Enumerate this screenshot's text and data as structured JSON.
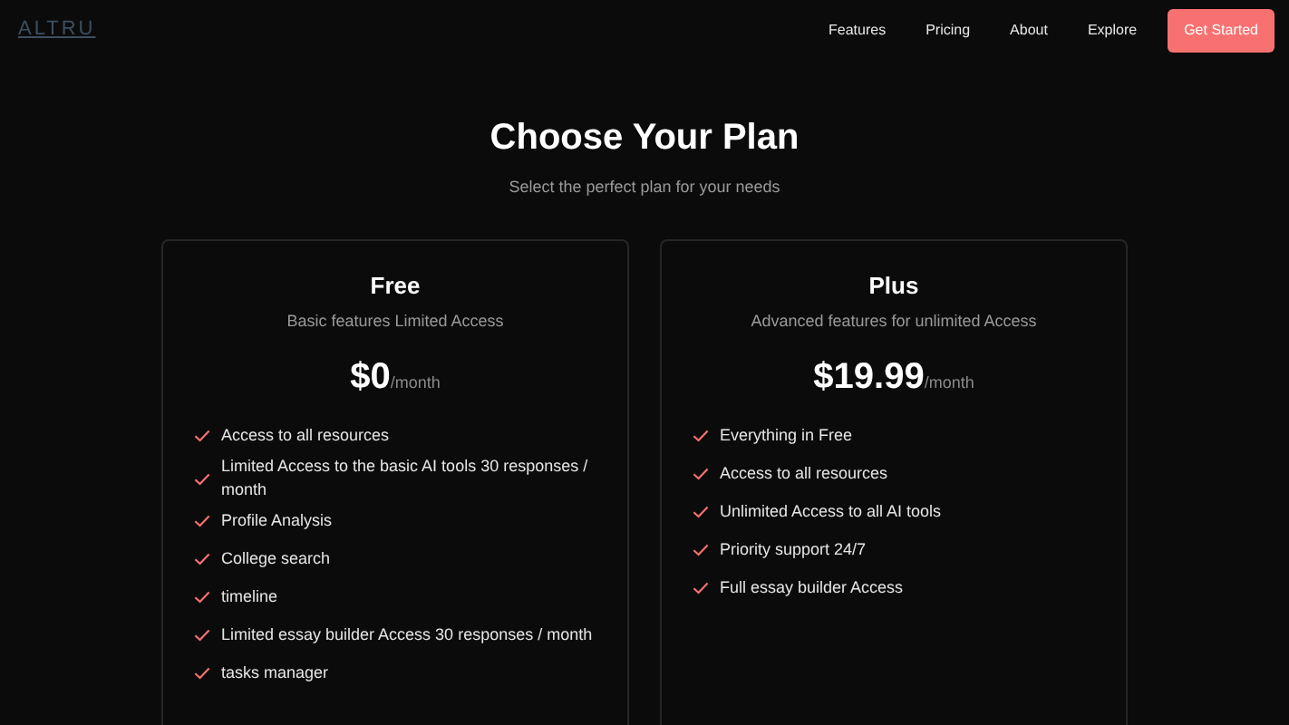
{
  "navbar": {
    "logo": "ALTRU",
    "links": [
      "Features",
      "Pricing",
      "About",
      "Explore"
    ],
    "cta": "Get Started"
  },
  "header": {
    "title": "Choose Your Plan",
    "subtitle": "Select the perfect plan for your needs"
  },
  "plans": [
    {
      "name": "Free",
      "description": "Basic features Limited Access",
      "price": "$0",
      "period": "/month",
      "features": [
        "Access to all resources",
        "Limited Access to the basic AI tools 30 responses / month",
        "Profile Analysis",
        "College search",
        "timeline",
        "Limited essay builder Access 30 responses / month",
        "tasks manager"
      ]
    },
    {
      "name": "Plus",
      "description": "Advanced features for unlimited Access",
      "price": "$19.99",
      "period": "/month",
      "features": [
        "Everything in Free",
        "Access to all resources",
        "Unlimited Access to all AI tools",
        "Priority support 24/7",
        "Full essay builder Access"
      ]
    }
  ]
}
